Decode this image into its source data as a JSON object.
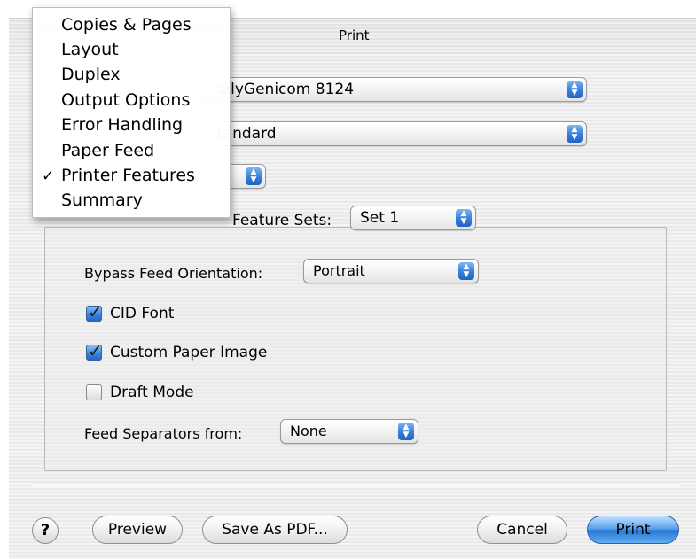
{
  "window": {
    "title": "Print"
  },
  "printer": {
    "value": "allyGenicom 8124"
  },
  "presets": {
    "value": "tandard"
  },
  "menu": {
    "items": [
      {
        "label": "Copies & Pages",
        "checked": false
      },
      {
        "label": "Layout",
        "checked": false
      },
      {
        "label": "Duplex",
        "checked": false
      },
      {
        "label": "Output Options",
        "checked": false
      },
      {
        "label": "Error Handling",
        "checked": false
      },
      {
        "label": "Paper Feed",
        "checked": false
      },
      {
        "label": "Printer Features",
        "checked": true
      },
      {
        "label": "Summary",
        "checked": false
      }
    ],
    "check_glyph": "✓"
  },
  "feature_sets": {
    "label": "Feature Sets:",
    "value": "Set 1"
  },
  "bypass": {
    "label": "Bypass Feed Orientation:",
    "value": "Portrait"
  },
  "checkboxes": [
    {
      "label": "CID Font",
      "checked": true
    },
    {
      "label": "Custom Paper Image",
      "checked": true
    },
    {
      "label": "Draft Mode",
      "checked": false
    }
  ],
  "feed_separators": {
    "label": "Feed Separators from:",
    "value": "None"
  },
  "buttons": {
    "help": "?",
    "preview": "Preview",
    "save_pdf": "Save As PDF...",
    "cancel": "Cancel",
    "print": "Print"
  },
  "popup_arrow_glyphs": {
    "up": "▲",
    "down": "▼"
  },
  "icons": {
    "help": "help-icon",
    "popup_arrows": "popup-arrows-icon",
    "check": "checkmark-icon"
  },
  "colors": {
    "accent": "#3a82dc",
    "default_button": "#5ba2ec"
  }
}
